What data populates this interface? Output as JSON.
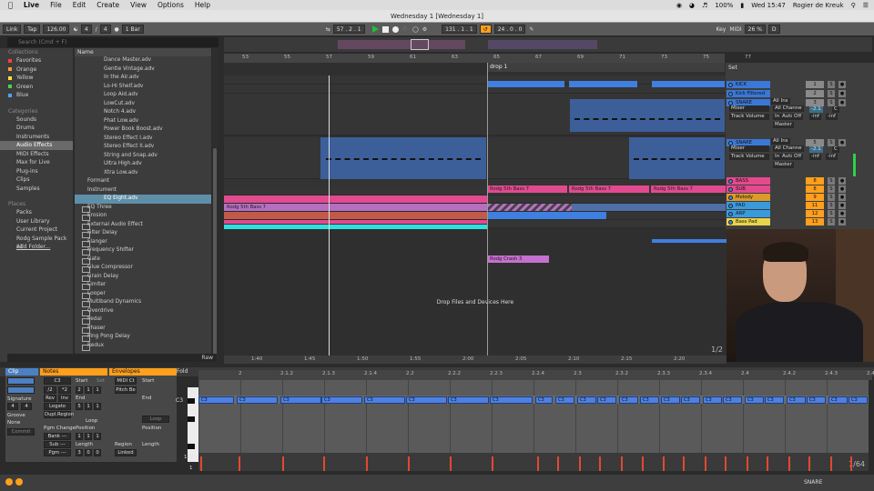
{
  "menubar": {
    "app": "Live",
    "items": [
      "File",
      "Edit",
      "Create",
      "View",
      "Options",
      "Help"
    ],
    "battery": "100%",
    "clock": "Wed 15:47",
    "user": "Rogier de Kreuk"
  },
  "window_title": "Wednesday 1  [Wednesday 1]",
  "transport": {
    "link": "Link",
    "tap": "Tap",
    "tempo": "126.00",
    "sig_num": "4",
    "sig_den": "4",
    "quantize": "1 Bar",
    "position": "57 .  2 .  1",
    "loop_start": "131 .  1 .  1",
    "loop_length": "24 .  0 .  0",
    "key": "Key",
    "midi": "MIDI",
    "cpu": "26 %",
    "d_label": "D"
  },
  "browser": {
    "search_placeholder": "Search (Cmd + F)",
    "collections_header": "Collections",
    "collections": [
      {
        "label": "Favorites",
        "color": "#ff4040"
      },
      {
        "label": "Orange",
        "color": "#ff9a2e"
      },
      {
        "label": "Yellow",
        "color": "#ffe13a"
      },
      {
        "label": "Green",
        "color": "#48d34a"
      },
      {
        "label": "Blue",
        "color": "#4da3ff"
      }
    ],
    "categories_header": "Categories",
    "categories": [
      "Sounds",
      "Drums",
      "Instruments",
      "Audio Effects",
      "MIDI Effects",
      "Max for Live",
      "Plug-ins",
      "Clips",
      "Samples"
    ],
    "selected_category": "Audio Effects",
    "places_header": "Places",
    "places": [
      "Packs",
      "User Library",
      "Current Project",
      "Rodg Sample Pack v1",
      "Add Folder..."
    ],
    "name_header": "Name",
    "files": [
      {
        "label": "Dance Master.adv",
        "type": "file"
      },
      {
        "label": "Gentle Vintage.adv",
        "type": "file"
      },
      {
        "label": "In the Air.adv",
        "type": "file"
      },
      {
        "label": "Lo-Hi Shelf.adv",
        "type": "file"
      },
      {
        "label": "Loop Aid.adv",
        "type": "file"
      },
      {
        "label": "LowCut.adv",
        "type": "file"
      },
      {
        "label": "Notch 4.adv",
        "type": "file"
      },
      {
        "label": "Phat Low.adv",
        "type": "file"
      },
      {
        "label": "Power Book Boost.adv",
        "type": "file"
      },
      {
        "label": "Stereo Effect I.adv",
        "type": "file"
      },
      {
        "label": "Stereo Effect II.adv",
        "type": "file"
      },
      {
        "label": "String and Snap.adv",
        "type": "file"
      },
      {
        "label": "Ultra High.adv",
        "type": "file"
      },
      {
        "label": "Xtra Low.adv",
        "type": "file"
      },
      {
        "label": "Formant",
        "type": "sub"
      },
      {
        "label": "Instrument",
        "type": "sub"
      },
      {
        "label": "EQ Eight.adv",
        "type": "selected"
      },
      {
        "label": "EQ Three",
        "type": "folder"
      },
      {
        "label": "Erosion",
        "type": "folder"
      },
      {
        "label": "External Audio Effect",
        "type": "folder"
      },
      {
        "label": "Filter Delay",
        "type": "folder"
      },
      {
        "label": "Flanger",
        "type": "folder"
      },
      {
        "label": "Frequency Shifter",
        "type": "folder"
      },
      {
        "label": "Gate",
        "type": "folder"
      },
      {
        "label": "Glue Compressor",
        "type": "folder"
      },
      {
        "label": "Grain Delay",
        "type": "folder"
      },
      {
        "label": "Limiter",
        "type": "folder"
      },
      {
        "label": "Looper",
        "type": "folder"
      },
      {
        "label": "Multiband Dynamics",
        "type": "folder"
      },
      {
        "label": "Overdrive",
        "type": "folder"
      },
      {
        "label": "Pedal",
        "type": "folder"
      },
      {
        "label": "Phaser",
        "type": "folder"
      },
      {
        "label": "Ping Pong Delay",
        "type": "folder"
      },
      {
        "label": "Redux",
        "type": "folder"
      }
    ],
    "raw_label": "Raw"
  },
  "arrangement": {
    "ruler_bars": [
      "53",
      "55",
      "57",
      "59",
      "61",
      "63",
      "65",
      "67",
      "69",
      "71",
      "73",
      "75",
      "77"
    ],
    "locator": "drop 1",
    "time_marks": [
      "1:40",
      "1:45",
      "1:50",
      "1:55",
      "2:00",
      "2:05",
      "2:10",
      "2:15",
      "2:20"
    ],
    "drop_hint": "Drop Files and Devices Here",
    "zoom_fraction": "1/2",
    "clip_labels": {
      "bass_a": "Rodg 5th Bass 7",
      "bass_b": "Rodg 5th Bass 7",
      "bass_c": "Rodg 5th Bass 7",
      "sub": "Rodg 5th Bass 7",
      "crash": "Rodg Crash 3"
    }
  },
  "tracks": {
    "set_label": "Set",
    "rows": [
      {
        "name": "KICK",
        "color": "#3a78d8",
        "num": "1"
      },
      {
        "name": "Kick Filtered",
        "color": "#3a78d8",
        "num": "2"
      },
      {
        "name": "SNARE",
        "color": "#3a78d8",
        "num": "3"
      },
      {
        "name": "SNARE",
        "color": "#3a78d8",
        "num": "5"
      },
      {
        "name": "BASS",
        "color": "#e54a8f",
        "num": "8"
      },
      {
        "name": "SUB",
        "color": "#e54a8f",
        "num": "8"
      },
      {
        "name": "Melody",
        "color": "#d99b2e",
        "num": "9"
      },
      {
        "name": "PAD",
        "color": "#3a9adc",
        "num": "11"
      },
      {
        "name": "ARP",
        "color": "#3a9adc",
        "num": "12"
      },
      {
        "name": "Bass Pad",
        "color": "#e8d44a",
        "num": "13"
      }
    ],
    "io": {
      "all_ins": "All Ins",
      "mixer": "Mixer",
      "all_channels": "All Channe",
      "track_volume": "Track Volume",
      "in": "In",
      "auto": "Auto",
      "off": "Off",
      "master": "Master",
      "vol_a": "-2.1",
      "inf": "-inf",
      "c": "C",
      "solo": "S"
    }
  },
  "detail": {
    "fold": "Fold",
    "clip_tab": "Clip",
    "notes_tab": "Notes",
    "envelopes_tab": "Envelopes",
    "note_name": "C3",
    "start_label": "Start",
    "set_label": "Set",
    "end_label": "End",
    "signature_label": "Signature",
    "sig": [
      "4",
      "4"
    ],
    "groove_label": "Groove",
    "groove_value": "None",
    "commit": "Commit",
    "div2": "/2",
    "mul2": "*2",
    "rev": "Rev",
    "inv": "Inv",
    "legato": "Legato",
    "dupl_region": "Dupl.Region",
    "start_vals": [
      "2",
      "1",
      "1"
    ],
    "end_vals": [
      "5",
      "1",
      "1"
    ],
    "loop_label": "Loop",
    "position_label": "Position",
    "pos_vals": [
      "1",
      "1",
      "1"
    ],
    "length_label": "Length",
    "len_vals": [
      "3",
      "0",
      "0"
    ],
    "pgm_change": "Pgm Change",
    "bank": "Bank ---",
    "sub": "Sub ---",
    "pgm": "Pgm ---",
    "midi_ctrl": "MIDI Ct",
    "pitch_bend": "Pitch Be",
    "env_start": "Start",
    "env_end": "End",
    "env_position": "Position",
    "env_loop": "Loop",
    "env_region": "Region",
    "env_length": "Length",
    "linked": "Linked",
    "ruler": [
      "2",
      "2.1.2",
      "2.1.3",
      "2.1.4",
      "2.2",
      "2.2.2",
      "2.2.3",
      "2.2.4",
      "2.3",
      "2.3.2",
      "2.3.3",
      "2.3.4",
      "2.4",
      "2.4.2",
      "2.4.3",
      "2.4.4"
    ],
    "key_label": "C3",
    "note_label": "C3",
    "vel_top": "127",
    "vel_bottom": "1",
    "grid_fraction": "1/64",
    "snare_label": "SNARE"
  }
}
